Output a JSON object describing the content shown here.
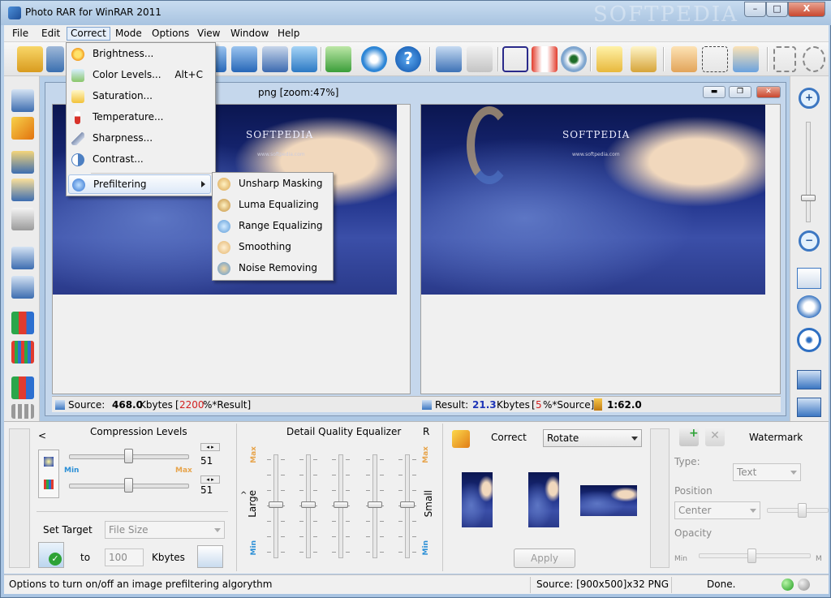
{
  "window": {
    "title": "Photo RAR for WinRAR 2011",
    "watermark": "SOFTPEDIA",
    "controls": {
      "minimize": "–",
      "maximize": "□",
      "close": "X"
    }
  },
  "menubar": [
    "File",
    "Edit",
    "Correct",
    "Mode",
    "Options",
    "View",
    "Window",
    "Help"
  ],
  "correct_menu": {
    "items": [
      {
        "label": "Brightness...",
        "shortcut": "",
        "icon": "sun-icon"
      },
      {
        "label": "Color Levels...",
        "shortcut": "Alt+C",
        "icon": "color-levels-icon"
      },
      {
        "label": "Saturation...",
        "shortcut": "",
        "icon": "saturation-icon"
      },
      {
        "label": "Temperature...",
        "shortcut": "",
        "icon": "thermometer-icon"
      },
      {
        "label": "Sharpness...",
        "shortcut": "",
        "icon": "sharpness-icon"
      },
      {
        "label": "Contrast...",
        "shortcut": "",
        "icon": "contrast-icon"
      }
    ],
    "prefiltering": "Prefiltering"
  },
  "prefilter_submenu": [
    "Unsharp Masking",
    "Luma Equalizing",
    "Range Equalizing",
    "Smoothing",
    "Noise Removing"
  ],
  "document": {
    "title": "png  [zoom:47%]",
    "brand": "SOFTPEDIA",
    "url": "www.softpedia.com",
    "source_label": "Source:",
    "source_size": "468.0",
    "source_unit": "Kbytes",
    "source_ratio": "2200",
    "source_ratio_suffix": "%*Result]",
    "result_label": "Result:",
    "result_size": "21.3",
    "result_unit": "Kbytes",
    "result_ratio": "5",
    "result_ratio_suffix": "%*Source]",
    "compression_ratio": "1:62.0"
  },
  "compression": {
    "arrow": "<",
    "title": "Compression Levels",
    "value1": "51",
    "value2": "51",
    "min": "Min",
    "max": "Max",
    "set_target": "Set Target",
    "target_type": "File Size",
    "to": "to",
    "target_value": "100",
    "target_unit": "Kbytes"
  },
  "equalizer": {
    "title": "Detail Quality Equalizer",
    "r": "R",
    "left_label": "Large",
    "right_label": "Small",
    "max": "Max",
    "min": "Min",
    "caret": "^",
    "levels": [
      0.55,
      0.55,
      0.55,
      0.55,
      0.55
    ]
  },
  "correct_panel": {
    "title": "Correct",
    "mode": "Rotate",
    "apply": "Apply"
  },
  "watermark_panel": {
    "title": "Watermark",
    "type_label": "Type:",
    "type_value": "Text",
    "position_label": "Position",
    "position_value": "Center",
    "opacity_label": "Opacity",
    "min": "Min",
    "max": "M"
  },
  "statusbar": {
    "hint": "Options to turn on/off an image prefiltering algorythm",
    "source_info": "Source: [900x500]x32 PNG",
    "state": "Done."
  }
}
